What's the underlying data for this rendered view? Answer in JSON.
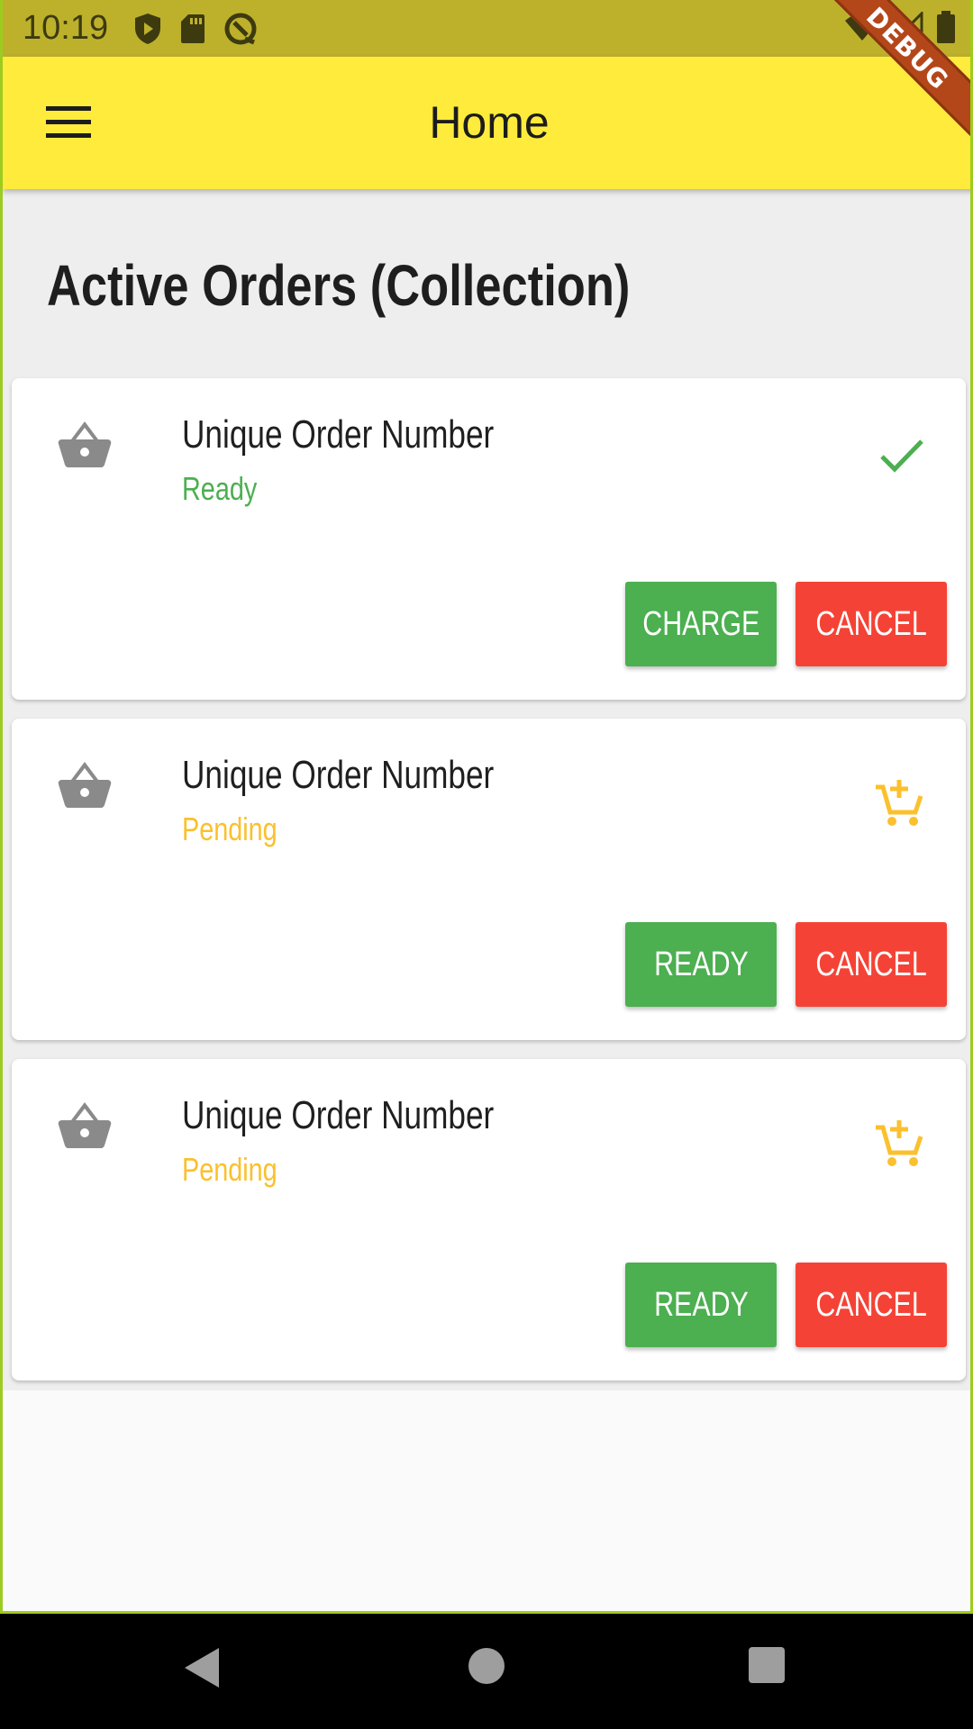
{
  "status_bar": {
    "time": "10:19"
  },
  "debug_banner": "DEBUG",
  "app_bar": {
    "title": "Home"
  },
  "section": {
    "title": "Active Orders (Collection)"
  },
  "orders": [
    {
      "title": "Unique Order Number",
      "status": "Ready",
      "status_color": "#4caf50",
      "action_icon": "check-icon",
      "primary_label": "CHARGE",
      "cancel_label": "CANCEL"
    },
    {
      "title": "Unique Order Number",
      "status": "Pending",
      "status_color": "#fbc02d",
      "action_icon": "add-shopping-cart-icon",
      "primary_label": "READY",
      "cancel_label": "CANCEL"
    },
    {
      "title": "Unique Order Number",
      "status": "Pending",
      "status_color": "#fbc02d",
      "action_icon": "add-shopping-cart-icon",
      "primary_label": "READY",
      "cancel_label": "CANCEL"
    }
  ],
  "colors": {
    "app_bar": "#ffeb3b",
    "primary_button": "#4caf50",
    "cancel_button": "#f44336",
    "pending": "#fbc02d",
    "ready": "#4caf50"
  }
}
